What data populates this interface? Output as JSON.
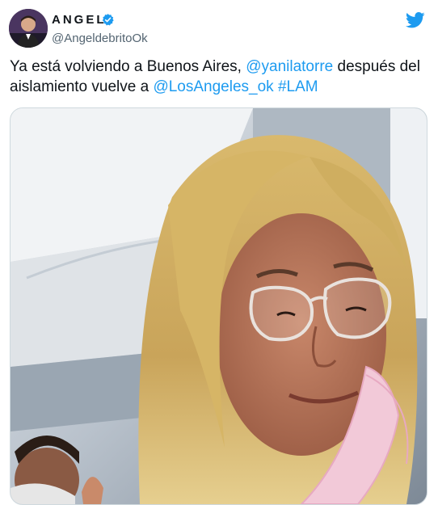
{
  "author": {
    "display_name": "ANGEL",
    "handle": "@AngeldebritoOk",
    "avatar_icon": "avatar-photo",
    "verified_icon": "verified-badge-icon"
  },
  "tweet": {
    "text_part1": "Ya está volviendo a Buenos Aires, ",
    "mention1": "@yanilatorre",
    "text_part2": " después del aislamiento vuelve a ",
    "mention2": "@LosAngeles_ok",
    "text_part3": " ",
    "hashtag": "#LAM"
  },
  "media": {
    "kind": "photo",
    "description_icon": "selfie-photo"
  },
  "brand": {
    "logo_icon": "twitter-bird-icon",
    "accent_color": "#1d9bf0"
  }
}
